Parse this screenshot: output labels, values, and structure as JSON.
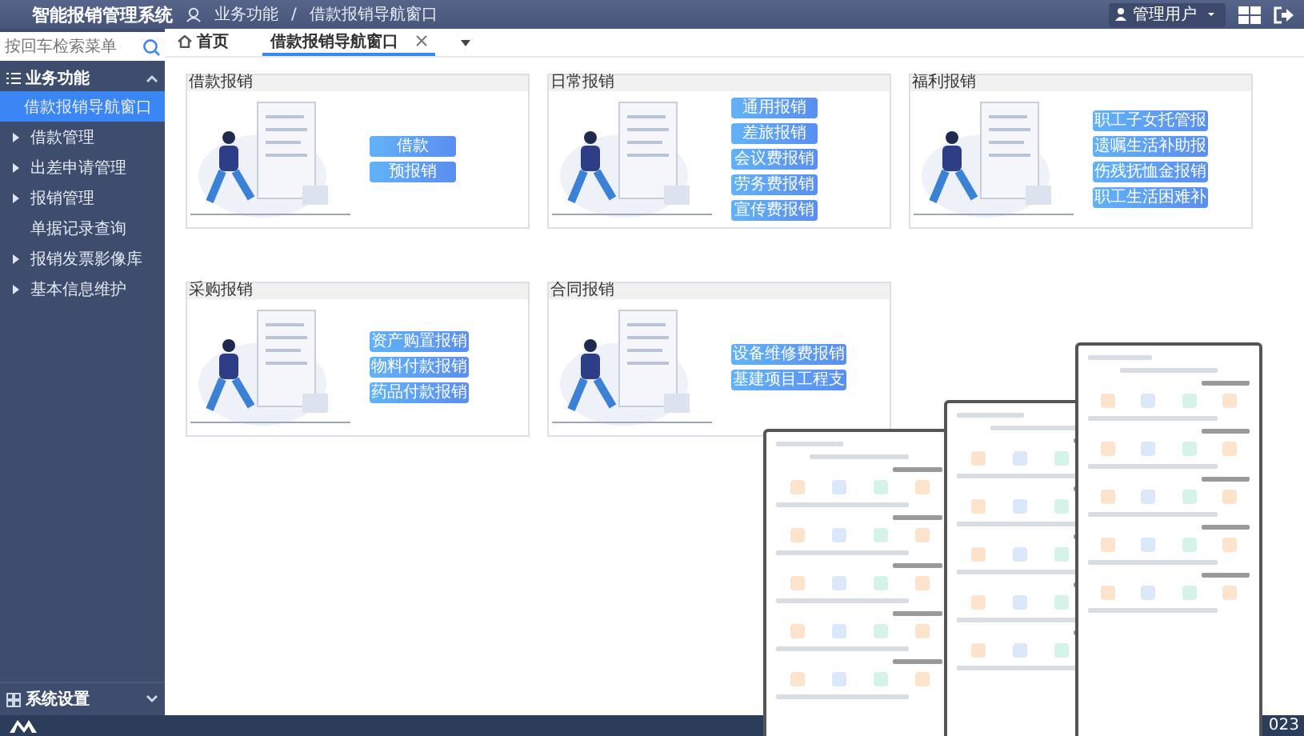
{
  "header": {
    "title": "智能报销管理系统",
    "breadcrumb": [
      "业务功能",
      "借款报销导航窗口"
    ],
    "separator": "/",
    "user": "管理用户"
  },
  "sidebar": {
    "search": {
      "placeholder": "按回车检索菜单"
    },
    "section": {
      "label": "业务功能",
      "expanded": true
    },
    "items": [
      {
        "label": "借款报销导航窗口",
        "selected": true,
        "kind": "leaf"
      },
      {
        "label": "借款管理",
        "selected": false,
        "kind": "group"
      },
      {
        "label": "出差申请管理",
        "selected": false,
        "kind": "group"
      },
      {
        "label": "报销管理",
        "selected": false,
        "kind": "group"
      },
      {
        "label": "单据记录查询",
        "selected": false,
        "kind": "leaf"
      },
      {
        "label": "报销发票影像库",
        "selected": false,
        "kind": "group"
      },
      {
        "label": "基本信息维护",
        "selected": false,
        "kind": "group"
      }
    ],
    "footer_section": {
      "label": "系统设置",
      "expanded": false
    }
  },
  "tabs": [
    {
      "label": "首页",
      "selected": false,
      "kind": "home"
    },
    {
      "label": "借款报销导航窗口",
      "selected": true,
      "kind": "closable"
    }
  ],
  "cards": [
    {
      "title": "借款报销",
      "buttons": [
        "借款",
        "预报销"
      ]
    },
    {
      "title": "日常报销",
      "buttons": [
        "通用报销",
        "差旅报销",
        "会议费报销",
        "劳务费报销",
        "宣传费报销"
      ]
    },
    {
      "title": "福利报销",
      "buttons": [
        "职工子女托管报",
        "遗嘱生活补助报",
        "伤残抚恤金报销",
        "职工生活困难补"
      ]
    },
    {
      "title": "采购报销",
      "buttons": [
        "资产购置报销",
        "物料付款报销",
        "药品付款报销"
      ]
    },
    {
      "title": "合同报销",
      "buttons": [
        "设备维修费报销",
        "基建项目工程支"
      ]
    }
  ],
  "footer": {
    "text": "023"
  }
}
